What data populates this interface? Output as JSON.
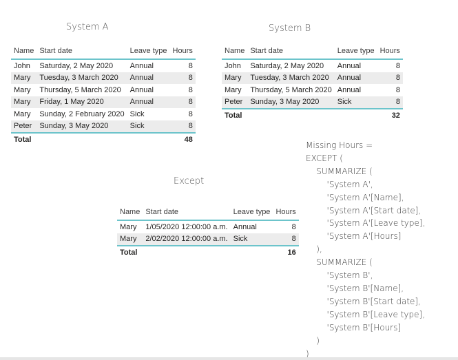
{
  "system_a": {
    "title": "System A",
    "columns": [
      "Name",
      "Start date",
      "Leave type",
      "Hours"
    ],
    "rows": [
      [
        "John",
        "Saturday, 2 May 2020",
        "Annual",
        "8"
      ],
      [
        "Mary",
        "Tuesday, 3 March 2020",
        "Annual",
        "8"
      ],
      [
        "Mary",
        "Thursday, 5 March 2020",
        "Annual",
        "8"
      ],
      [
        "Mary",
        "Friday, 1 May 2020",
        "Annual",
        "8"
      ],
      [
        "Mary",
        "Sunday, 2 February 2020",
        "Sick",
        "8"
      ],
      [
        "Peter",
        "Sunday, 3 May 2020",
        "Sick",
        "8"
      ]
    ],
    "total_label": "Total",
    "total_value": "48"
  },
  "system_b": {
    "title": "System B",
    "columns": [
      "Name",
      "Start date",
      "Leave type",
      "Hours"
    ],
    "rows": [
      [
        "John",
        "Saturday, 2 May 2020",
        "Annual",
        "8"
      ],
      [
        "Mary",
        "Tuesday, 3 March 2020",
        "Annual",
        "8"
      ],
      [
        "Mary",
        "Thursday, 5 March 2020",
        "Annual",
        "8"
      ],
      [
        "Peter",
        "Sunday, 3 May 2020",
        "Sick",
        "8"
      ]
    ],
    "total_label": "Total",
    "total_value": "32"
  },
  "except": {
    "title": "Except",
    "columns": [
      "Name",
      "Start date",
      "Leave type",
      "Hours"
    ],
    "rows": [
      [
        "Mary",
        "1/05/2020 12:00:00 a.m.",
        "Annual",
        "8"
      ],
      [
        "Mary",
        "2/02/2020 12:00:00 a.m.",
        "Sick",
        "8"
      ]
    ],
    "total_label": "Total",
    "total_value": "16"
  },
  "dax_lines": [
    "Missing Hours =",
    "EXCEPT (",
    "    SUMMARIZE (",
    "        'System A',",
    "        'System A'[Name],",
    "        'System A'[Start date],",
    "        'System A'[Leave type],",
    "        'System A'[Hours]",
    "    ),",
    "    SUMMARIZE (",
    "        'System B',",
    "        'System B'[Name],",
    "        'System B'[Start date],",
    "        'System B'[Leave type],",
    "        'System B'[Hours]",
    "    )",
    ")"
  ],
  "colors": {
    "accent": "#6cc4cb",
    "band": "#ececec",
    "text": "#252423"
  }
}
